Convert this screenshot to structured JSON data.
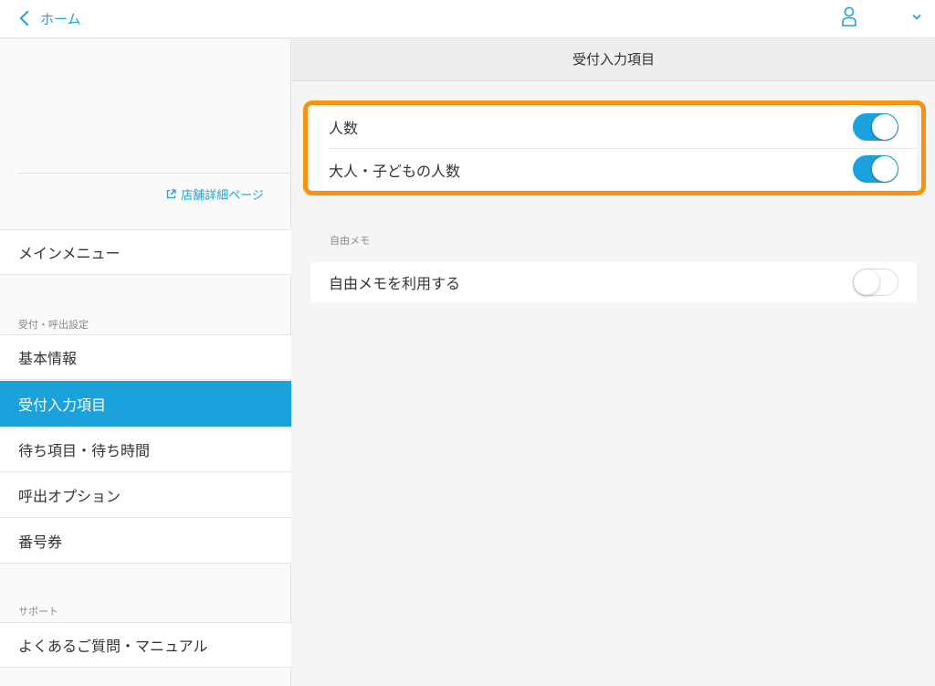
{
  "header": {
    "back_label": "ホーム"
  },
  "sidebar": {
    "store_link": "店舗詳細ページ",
    "main_menu": "メインメニュー",
    "section1": "受付・呼出設定",
    "items": [
      {
        "label": "基本情報",
        "active": false
      },
      {
        "label": "受付入力項目",
        "active": true
      },
      {
        "label": "待ち項目・待ち時間",
        "active": false
      },
      {
        "label": "呼出オプション",
        "active": false
      },
      {
        "label": "番号券",
        "active": false
      }
    ],
    "section2": "サポート",
    "support_items": [
      {
        "label": "よくあるご質問・マニュアル"
      }
    ]
  },
  "main": {
    "title": "受付入力項目",
    "toggles": [
      {
        "label": "人数",
        "state": "on"
      },
      {
        "label": "大人・子どもの人数",
        "state": "on"
      }
    ],
    "memo_section": "自由メモ",
    "memo_toggle": {
      "label": "自由メモを利用する",
      "state": "off"
    }
  },
  "colors": {
    "accent": "#1ba2dc",
    "highlight": "#f7940f"
  }
}
